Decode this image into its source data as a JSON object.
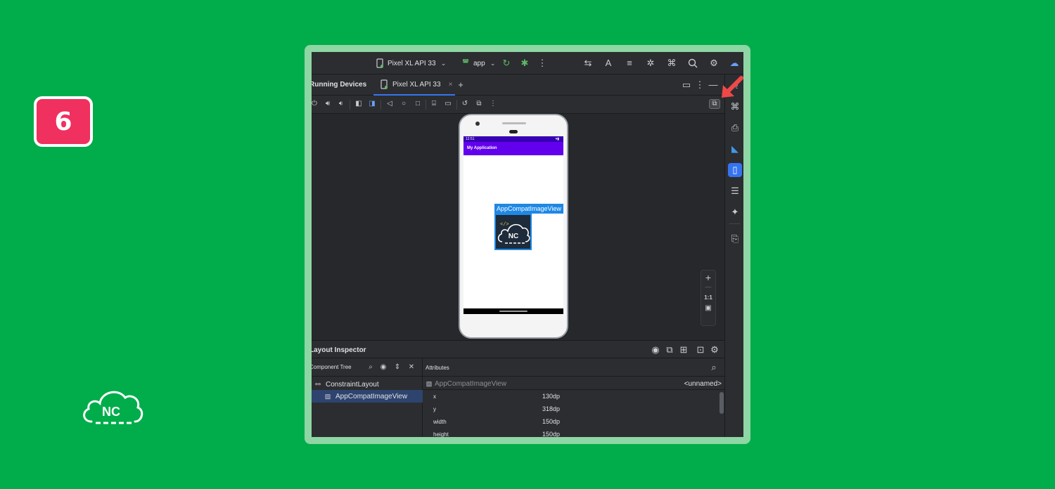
{
  "step": {
    "number": "6"
  },
  "brand": {
    "logo_text": "NC"
  },
  "toolbar": {
    "device_selector": "Pixel XL API 33",
    "run_config": "app"
  },
  "running_devices": {
    "title": "Running Devices",
    "tab_label": "Pixel XL API 33"
  },
  "emulator": {
    "status_time": "12:51",
    "app_title": "My Application",
    "selected_view_label": "AppCompatImageView",
    "image_text": "NC",
    "code_glyph": "</>"
  },
  "zoom": {
    "plus": "+",
    "minus": "—",
    "one_to_one": "1:1"
  },
  "layout_inspector": {
    "title": "Layout Inspector",
    "component_tree": {
      "title": "Component Tree",
      "nodes": [
        {
          "label": "ConstraintLayout"
        },
        {
          "label": "AppCompatImageView"
        }
      ]
    },
    "attributes": {
      "title": "Attributes",
      "component": "AppCompatImageView",
      "name": "<unnamed>",
      "rows": [
        {
          "key": "x",
          "value": "130dp"
        },
        {
          "key": "y",
          "value": "318dp"
        },
        {
          "key": "width",
          "value": "150dp"
        },
        {
          "key": "height",
          "value": "150dp"
        }
      ]
    }
  },
  "colors": {
    "background": "#00ad4a",
    "badge": "#f0305e",
    "accent": "#3574f0",
    "app_bar": "#6200ee",
    "arrow": "#f04848"
  }
}
